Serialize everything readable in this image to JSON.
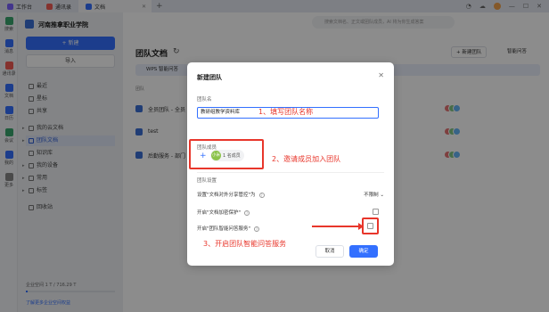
{
  "tabs": [
    {
      "label": "工作台",
      "color": "#7b61ff"
    },
    {
      "label": "通讯录",
      "color": "#f25c54"
    },
    {
      "label": "文档",
      "color": "#3370ff"
    }
  ],
  "titlebar_right": [
    "播放库"
  ],
  "rail": [
    {
      "label": "搜索",
      "color": "#3aa76d"
    },
    {
      "label": "消息",
      "color": "#3370ff",
      "badge": "1"
    },
    {
      "label": "通讯录",
      "color": "#f25c54"
    },
    {
      "label": "文档",
      "color": "#3370ff"
    },
    {
      "label": "日历",
      "color": "#3370ff"
    },
    {
      "label": "会议",
      "color": "#3aa76d"
    },
    {
      "label": "我的",
      "color": "#3370ff"
    },
    {
      "label": "更多",
      "color": "#888888"
    }
  ],
  "nav": {
    "org_name": "河南推拿职业学院",
    "new_label": "+ 新建",
    "import_label": "导入",
    "items": [
      {
        "label": "最近"
      },
      {
        "label": "星标"
      },
      {
        "label": "共享"
      },
      {
        "label": "我的云文档"
      },
      {
        "label": "团队文档"
      },
      {
        "label": "知识库"
      },
      {
        "label": "我的设备"
      },
      {
        "label": "常用"
      },
      {
        "label": "标签"
      },
      {
        "label": "回收站"
      }
    ],
    "quota_text": "企业空间 1 T / 716.29 T",
    "quota_fraction": 0.02,
    "quota_link": "了解更多企业空间权益"
  },
  "main": {
    "search_placeholder": "搜索文档名、正文或团队成员，AI 将为你生成答案",
    "title": "团队文档",
    "new_team": "+ 新建团队",
    "smart_qa": "智能问答",
    "notice": "WPS 智能问答",
    "list_header": "团队",
    "rows": [
      {
        "name": "全员团队 - 全员"
      },
      {
        "name": "test"
      },
      {
        "name": "后勤服务 - 部门"
      }
    ]
  },
  "dialog": {
    "title": "新建团队",
    "name_label": "团队名",
    "name_value": "教研组教学资料库",
    "members_label": "团队成员",
    "member_avatar": "小米",
    "member_count": "1 名成员",
    "settings_label": "团队设置",
    "setting1": "设置\"文档对外分享管控\"为",
    "setting1_value": "不限制",
    "setting2": "开启\"文档加密保护\"",
    "setting3": "开启\"团队智能问答服务\"",
    "cancel": "取消",
    "ok": "确定"
  },
  "annotations": {
    "step1": "1、填写团队名称",
    "step2": "2、邀请成员加入团队",
    "step3": "3、开启团队智能问答服务"
  },
  "colors": {
    "accent": "#3370ff",
    "annotation": "#e8362b"
  }
}
